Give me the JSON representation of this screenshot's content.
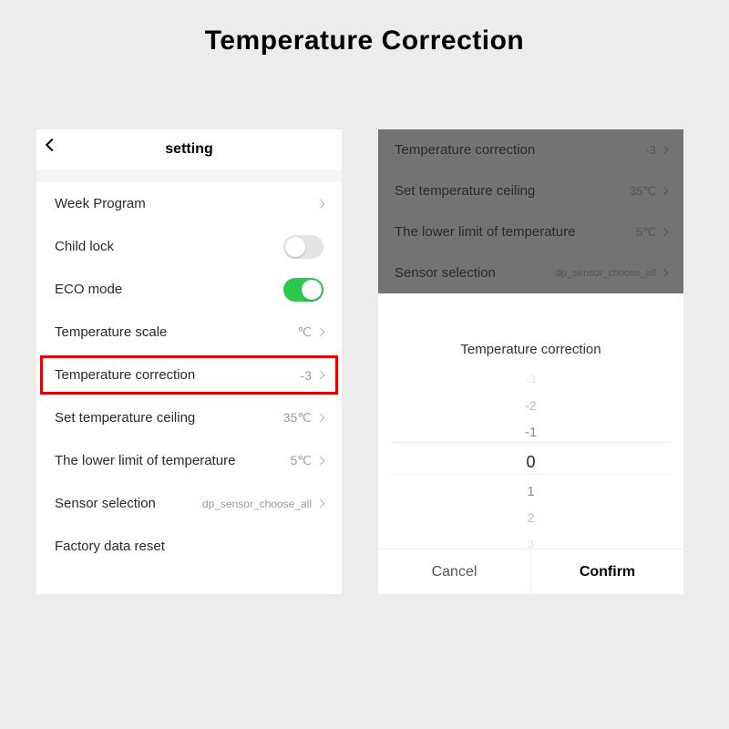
{
  "page_title": "Temperature Correction",
  "left": {
    "header_title": "setting",
    "rows": [
      {
        "label": "Week Program",
        "kind": "chevron"
      },
      {
        "label": "Child lock",
        "kind": "toggle",
        "on": false
      },
      {
        "label": "ECO mode",
        "kind": "toggle",
        "on": true
      },
      {
        "label": "Temperature scale",
        "kind": "value_chevron",
        "value": "℃"
      },
      {
        "label": "Temperature correction",
        "kind": "value_chevron",
        "value": "-3",
        "highlight": true
      },
      {
        "label": "Set temperature ceiling",
        "kind": "value_chevron",
        "value": "35℃"
      },
      {
        "label": "The lower limit of temperature",
        "kind": "value_chevron",
        "value": "5℃"
      },
      {
        "label": "Sensor selection",
        "kind": "value_chevron",
        "value": "dp_sensor_choose_all"
      },
      {
        "label": "Factory data reset",
        "kind": "plain"
      }
    ]
  },
  "right": {
    "bg_rows": [
      {
        "label": "Temperature correction",
        "value": "-3"
      },
      {
        "label": "Set temperature ceiling",
        "value": "35℃"
      },
      {
        "label": "The lower limit of temperature",
        "value": "5℃"
      },
      {
        "label": "Sensor selection",
        "value": "dp_sensor_choose_all"
      }
    ],
    "sheet": {
      "title": "Temperature correction",
      "options": [
        "-3",
        "-2",
        "-1",
        "0",
        "1",
        "2",
        "3"
      ],
      "selected": "0",
      "cancel": "Cancel",
      "confirm": "Confirm"
    }
  }
}
